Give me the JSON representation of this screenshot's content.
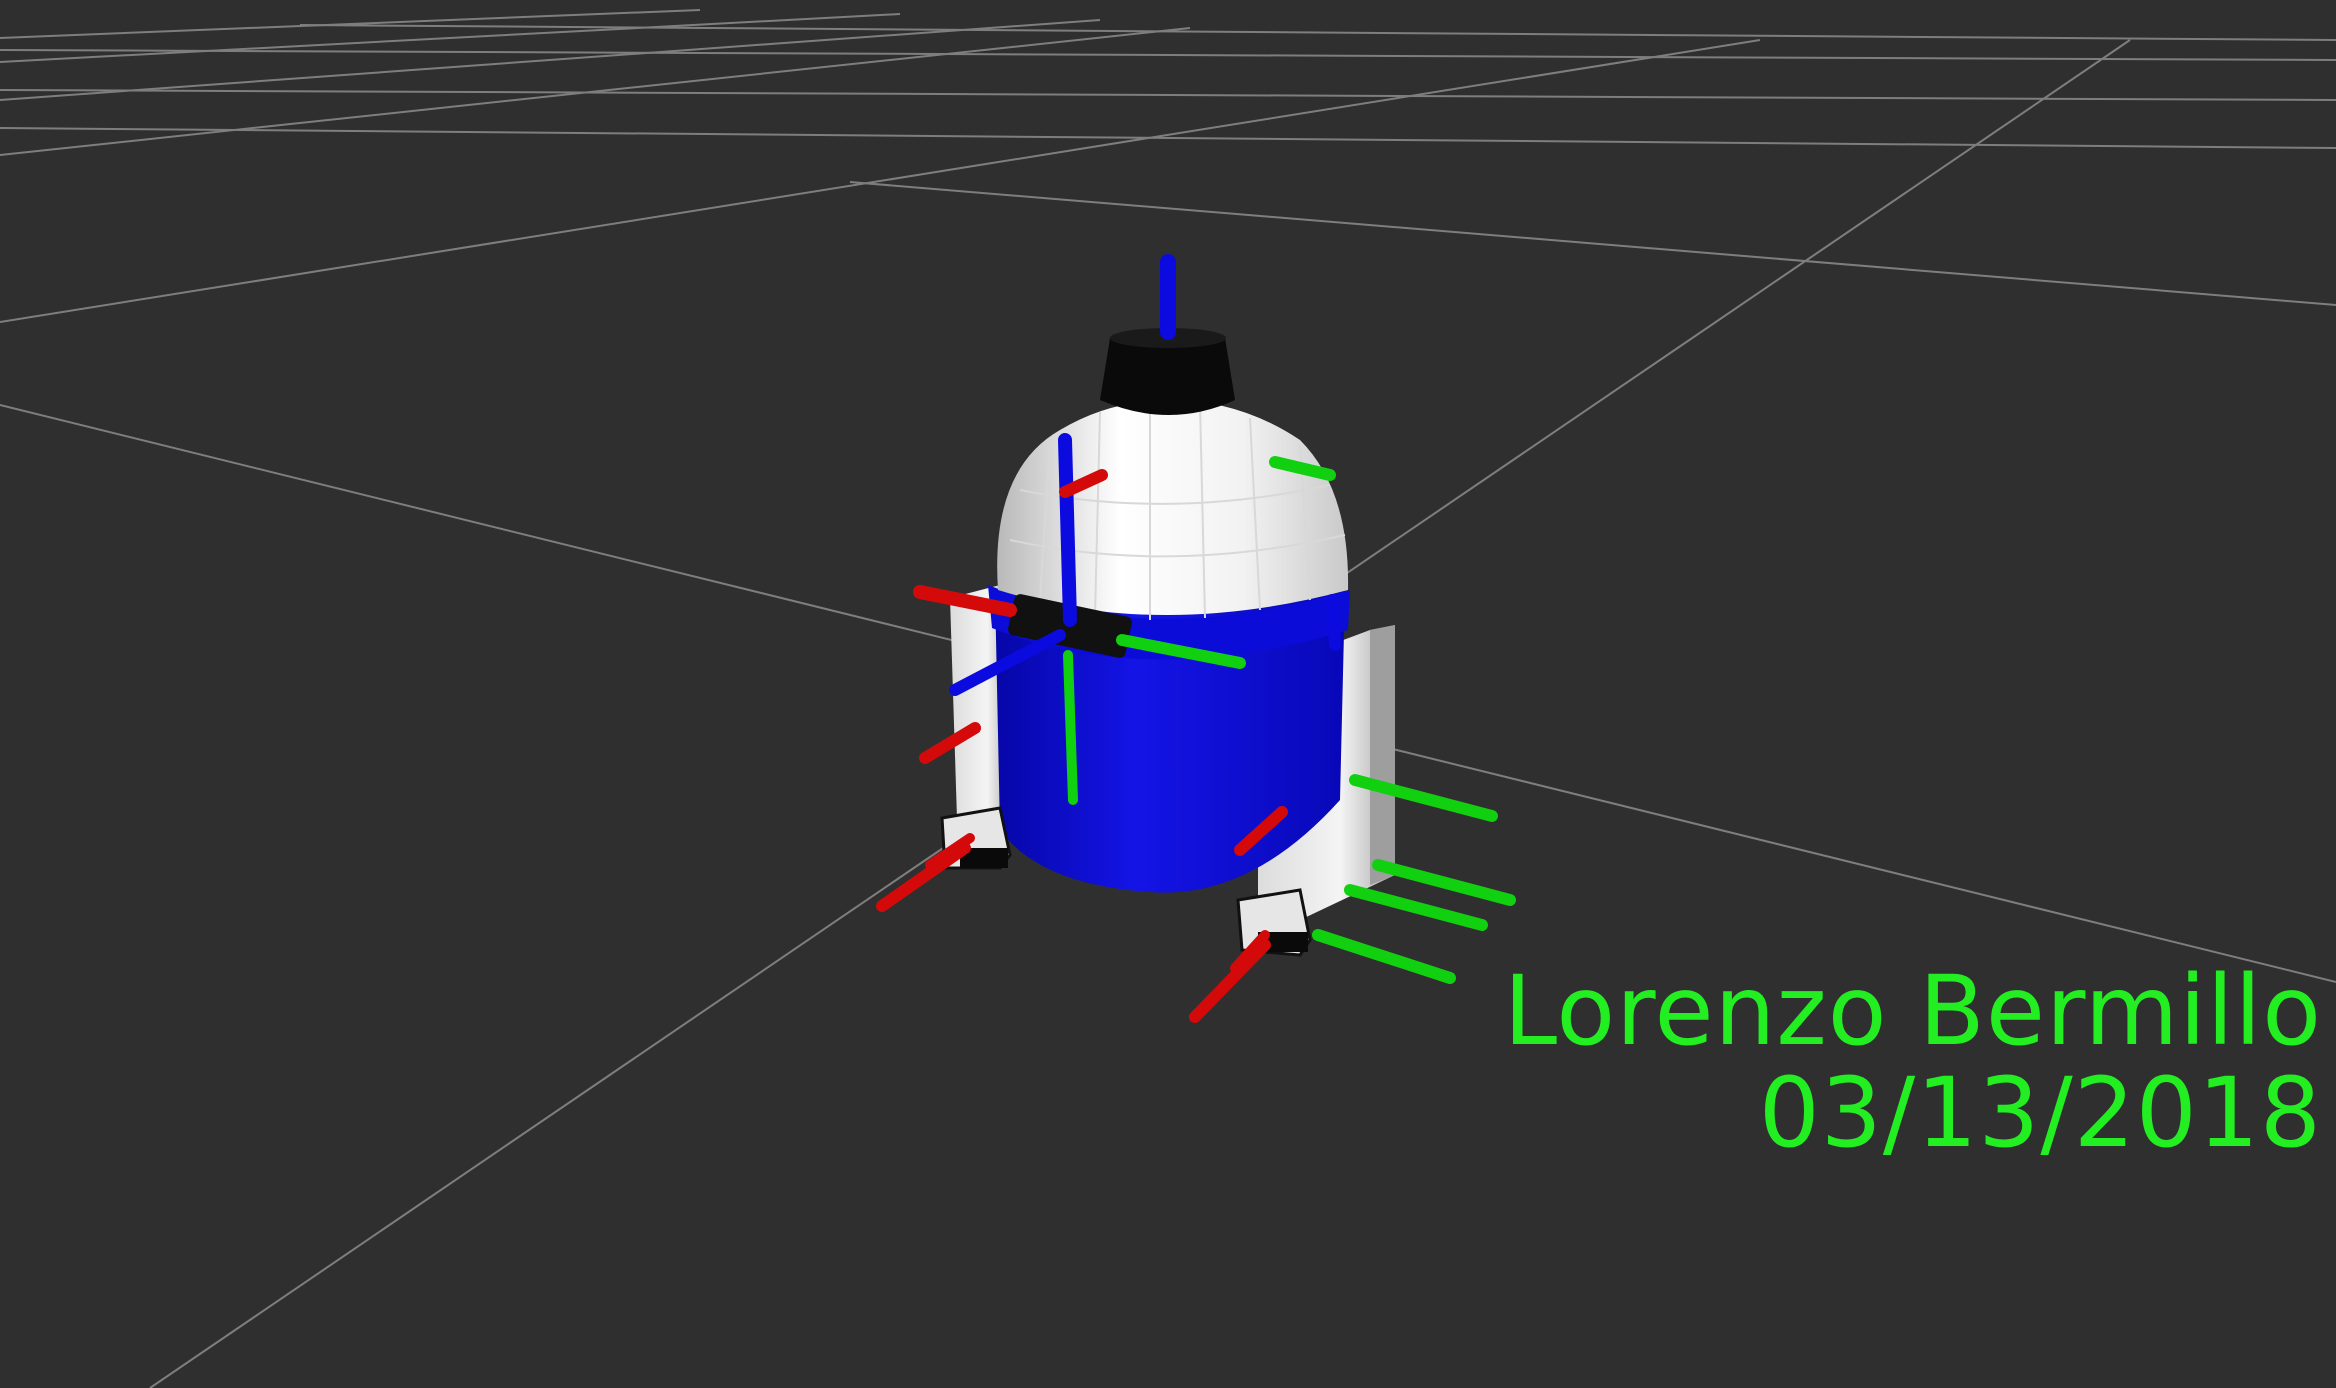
{
  "viewport": {
    "background": "#2f2f2f",
    "grid_color": "#8a8a8a"
  },
  "overlay": {
    "name": "Lorenzo Bermillo",
    "date": "03/13/2018",
    "color": "#22ee22"
  },
  "robot": {
    "body_color": "#0a0ad0",
    "dome_color": "#f0f0f0",
    "cap_color": "#080808",
    "axis_colors": {
      "x": "#cc0000",
      "y": "#00cc00",
      "z": "#0000dd"
    }
  }
}
